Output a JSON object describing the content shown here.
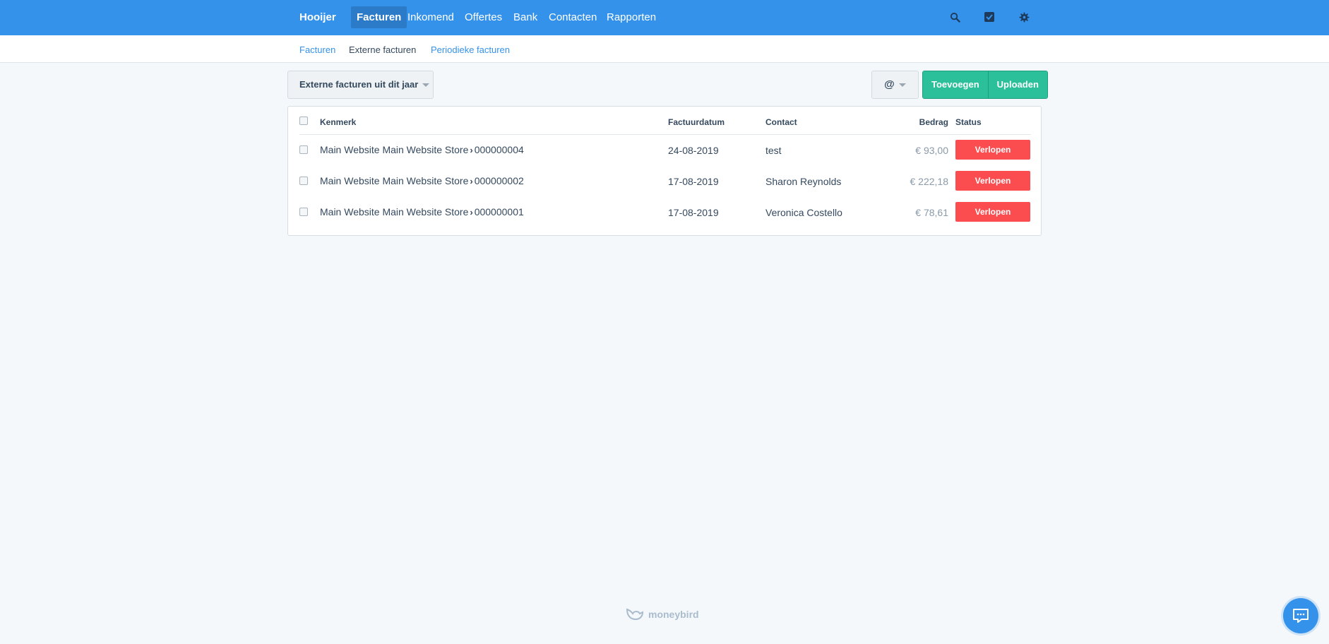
{
  "brand": "Hooijer",
  "nav": {
    "items": [
      {
        "label": "Facturen",
        "active": true
      },
      {
        "label": "Inkomend"
      },
      {
        "label": "Offertes"
      },
      {
        "label": "Bank"
      },
      {
        "label": "Contacten"
      },
      {
        "label": "Rapporten"
      }
    ],
    "icons": [
      "search-icon",
      "checkbox-icon",
      "gear-icon"
    ]
  },
  "subnav": {
    "items": [
      {
        "label": "Facturen"
      },
      {
        "label": "Externe facturen",
        "current": true
      },
      {
        "label": "Periodieke facturen"
      }
    ]
  },
  "toolbar": {
    "filter_label": "Externe facturen uit dit jaar",
    "at_label": "@",
    "add_label": "Toevoegen",
    "upload_label": "Uploaden"
  },
  "table": {
    "headers": {
      "reference": "Kenmerk",
      "date": "Factuurdatum",
      "contact": "Contact",
      "amount": "Bedrag",
      "status": "Status"
    },
    "rows": [
      {
        "store": "Main Website Main Website Store",
        "number": "000000004",
        "date": "24-08-2019",
        "contact": "test",
        "amount": "€ 93,00",
        "status": "Verlopen"
      },
      {
        "store": "Main Website Main Website Store",
        "number": "000000002",
        "date": "17-08-2019",
        "contact": "Sharon Reynolds",
        "amount": "€ 222,18",
        "status": "Verlopen"
      },
      {
        "store": "Main Website Main Website Store",
        "number": "000000001",
        "date": "17-08-2019",
        "contact": "Veronica Costello",
        "amount": "€ 78,61",
        "status": "Verlopen"
      }
    ]
  },
  "footer": {
    "logo_text": "moneybird"
  },
  "colors": {
    "primary": "#3592ea",
    "success": "#2bbf9a",
    "danger": "#fb4c4f",
    "background": "#f5f8fb"
  }
}
